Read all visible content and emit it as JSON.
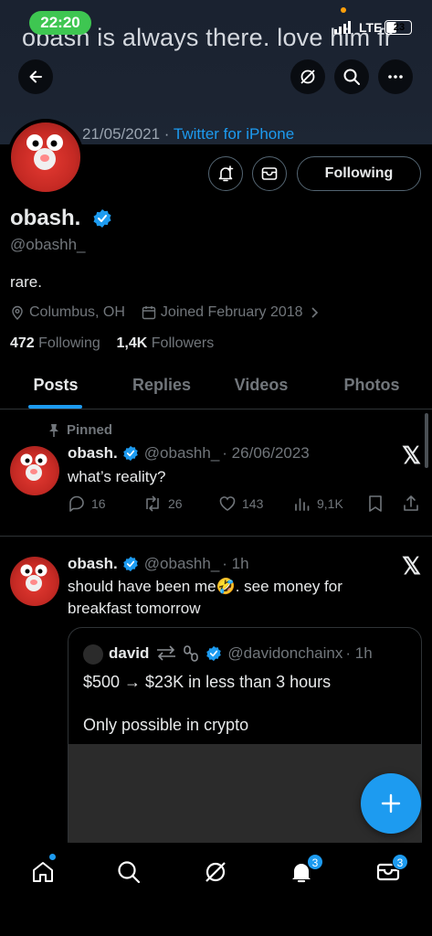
{
  "status_bar": {
    "time": "22:20",
    "network": "LTE",
    "battery": "23"
  },
  "banner": {
    "text": "obash is always there. love him fr",
    "date": "21/05/2021 · ",
    "source": "Twitter for iPhone"
  },
  "profile": {
    "name": "obash.",
    "handle": "@obashh_",
    "bio": "rare.",
    "location": "Columbus, OH",
    "joined": "Joined February 2018",
    "following_count": "472",
    "following_label": "Following",
    "followers_count": "1,4K",
    "followers_label": "Followers",
    "follow_button": "Following"
  },
  "tabs": [
    {
      "label": "Posts"
    },
    {
      "label": "Replies"
    },
    {
      "label": "Videos"
    },
    {
      "label": "Photos"
    }
  ],
  "tweets": [
    {
      "pinned_label": "Pinned",
      "name": "obash.",
      "handle": "@obashh_",
      "time": "· 26/06/2023",
      "text": "what’s reality?",
      "replies": "16",
      "retweets": "26",
      "likes": "143",
      "views": "9,1K"
    },
    {
      "name": "obash.",
      "handle": "@obashh_",
      "time": "· 1h",
      "text_line1": "should have been me🤣. see money for",
      "text_line2": "breakfast tomorrow",
      "quote": {
        "name": "david",
        "handle": "@davidonchainx",
        "time": "· 1h",
        "line1": "$500 → $23K in less than 3 hours",
        "line2": "Only possible in crypto"
      }
    }
  ],
  "bottom_nav": {
    "notifications_badge": "3",
    "messages_badge": "3"
  },
  "colors": {
    "accent": "#1d9bf0",
    "background": "#000000",
    "muted": "#71767b"
  }
}
